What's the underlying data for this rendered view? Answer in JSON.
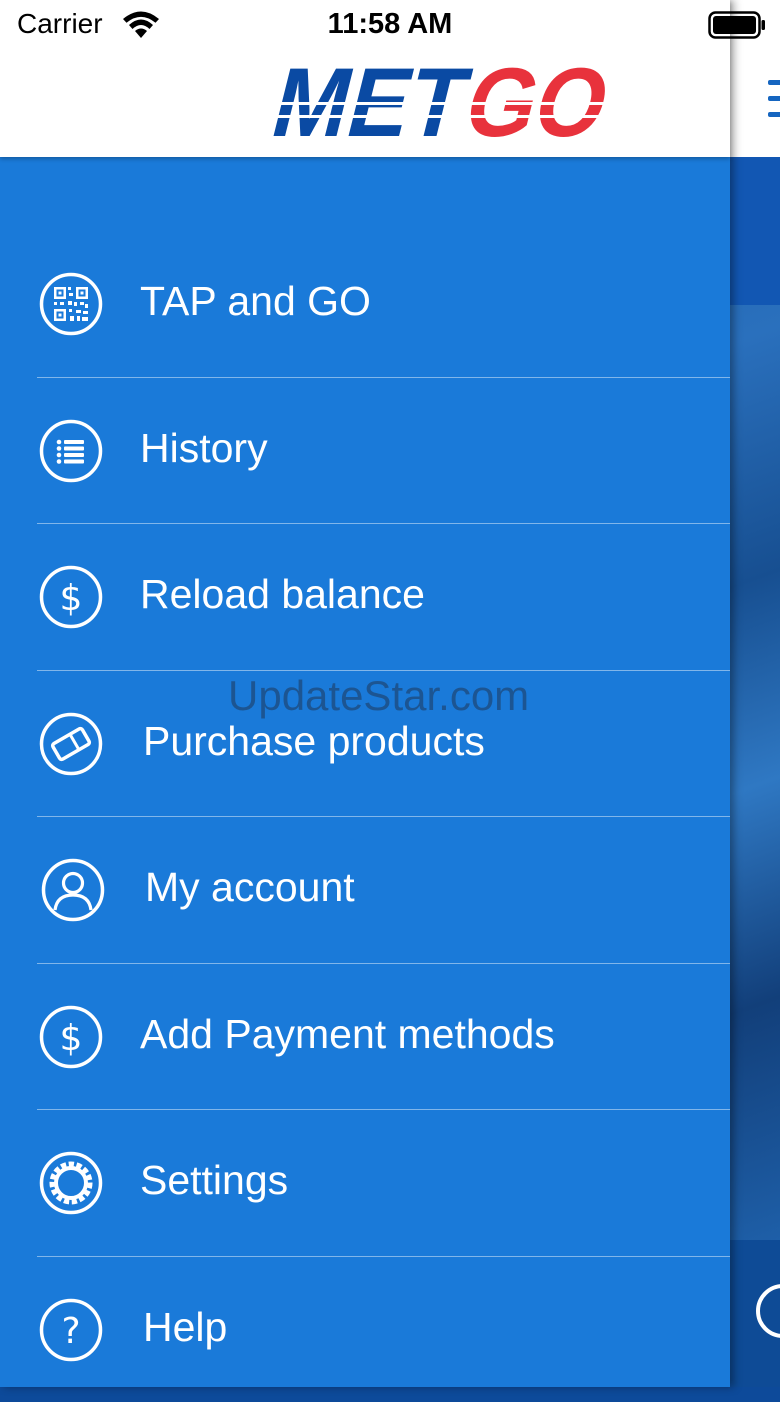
{
  "status_bar": {
    "carrier": "Carrier",
    "time": "11:58 AM"
  },
  "brand": {
    "logo_text": "METGO",
    "accent_blue": "#0a4aa3",
    "accent_red": "#e8323c"
  },
  "drawer": {
    "background": "#1a7ad9",
    "items": [
      {
        "label": "TAP and GO",
        "icon": "qr-code-icon"
      },
      {
        "label": "History",
        "icon": "list-icon"
      },
      {
        "label": "Reload balance",
        "icon": "dollar-icon"
      },
      {
        "label": "Purchase products",
        "icon": "ticket-icon"
      },
      {
        "label": "My account",
        "icon": "user-icon"
      },
      {
        "label": "Add Payment methods",
        "icon": "dollar-icon"
      },
      {
        "label": "Settings",
        "icon": "gear-icon"
      },
      {
        "label": "Help",
        "icon": "help-icon"
      }
    ]
  },
  "watermark": "UpdateStar.com"
}
